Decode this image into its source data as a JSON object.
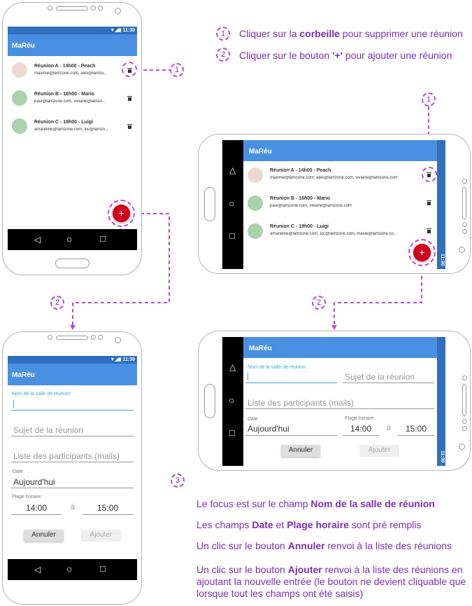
{
  "app": {
    "title": "MaRéu",
    "time": "11:30"
  },
  "meetings": [
    {
      "title": "Réunion A - 14h00 - Peach",
      "emails_short": "maxime@lamzone.com, alex@lamzo...",
      "emails_long": "maxime@lamzone.com, alex@lamzone.com, viviane@lamzone.com",
      "avatar_color": "#f0d8d2"
    },
    {
      "title": "Réunion B - 16h00 - Mario",
      "emails_short": "paul@lamzone.com, viviane@lamzo...",
      "emails_long": "paul@lamzone.com, viviane@lamzone.com",
      "avatar_color": "#abd1ae"
    },
    {
      "title": "Réunion C - 19h00 - Luigi",
      "emails_short": "amandine@lamzone.com, luc@lamzo...",
      "emails_long": "amandine@lamzone.com, luc@lamzone.com, maxie@lamzone.co...",
      "avatar_color": "#abd1ae"
    }
  ],
  "fab_label": "+",
  "form": {
    "room_label": "Nom de la salle de réunion",
    "subject_hint": "Sujet de la réunion",
    "participants_hint": "Liste des participants (mails)",
    "date_label": "Date",
    "date_value": "Aujourd'hui",
    "time_label": "Plage horaire",
    "time_start": "14:00",
    "time_sep": "à",
    "time_end": "15:00",
    "cancel": "Annuler",
    "add": "Ajouter"
  },
  "badges": {
    "one": "1",
    "two": "2",
    "three": "3"
  },
  "instructions": {
    "step1_pre": "Cliquer sur la ",
    "step1_bold": "corbeille",
    "step1_post": " pour supprimer une réunion",
    "step2_pre": "Cliquer sur le bouton ",
    "step2_bold": "'+'",
    "step2_post": " pour ajouter une réunion"
  },
  "notes": {
    "n1_pre": "Le focus est sur le champ ",
    "n1_bold": "Nom de la salle de réunion",
    "n2_pre": "Les champs ",
    "n2_bold1": "Date",
    "n2_mid": " et ",
    "n2_bold2": "Plage horaire",
    "n2_post": " sont pré remplis",
    "n3_pre": "Un clic sur le bouton ",
    "n3_bold": "Annuler",
    "n3_post": " renvoi à la liste des réunions",
    "n4_pre": "Un clic sur le bouton ",
    "n4_bold": "Ajouter",
    "n4_post": " renvoi à la liste des réunions en ajoutant la nouvelle entrée (le bouton ne devient cliquable que lorsque tout les champs ont été saisis)"
  },
  "icons": {
    "back": "back-icon",
    "home": "home-icon",
    "recents": "recents-icon",
    "trash": "trash-icon"
  },
  "colors": {
    "appbar": "#4a90e2",
    "statusbar": "#2f6fbd",
    "fab": "#d0021b",
    "annotation": "#7b2fb0",
    "focus": "#3aa6d8"
  }
}
